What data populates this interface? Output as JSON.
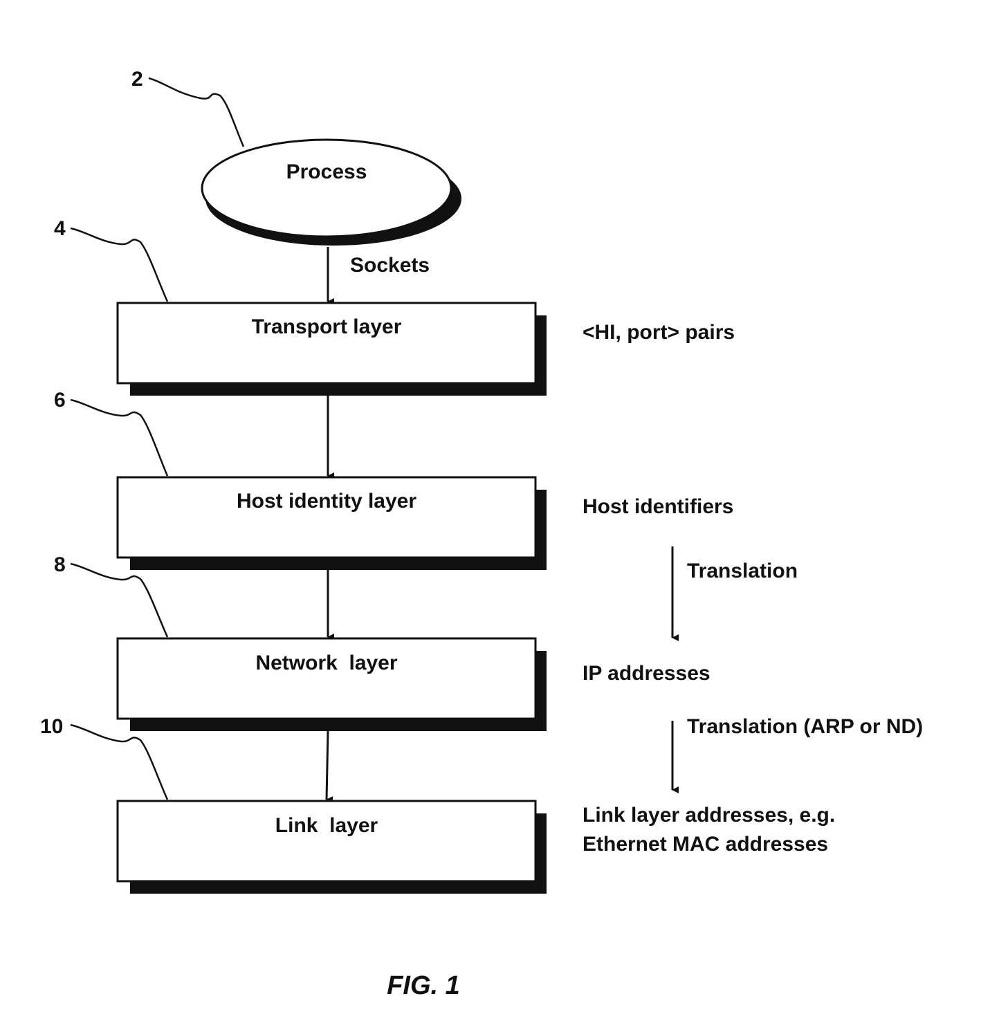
{
  "figure": {
    "caption": "FIG. 1",
    "process": {
      "ref": "2",
      "label": "Process"
    },
    "interface_label": "Sockets",
    "layers": [
      {
        "ref": "4",
        "label": "Transport layer",
        "side_label": "<HI, port> pairs"
      },
      {
        "ref": "6",
        "label": "Host identity layer",
        "side_label": "Host identifiers"
      },
      {
        "ref": "8",
        "label": "Network  layer",
        "side_label": "IP addresses"
      },
      {
        "ref": "10",
        "label": "Link  layer",
        "side_label_lines": [
          "Link layer addresses, e.g.",
          "Ethernet MAC addresses"
        ]
      }
    ],
    "translations": [
      {
        "label": "Translation"
      },
      {
        "label": "Translation (ARP or ND)"
      }
    ]
  }
}
